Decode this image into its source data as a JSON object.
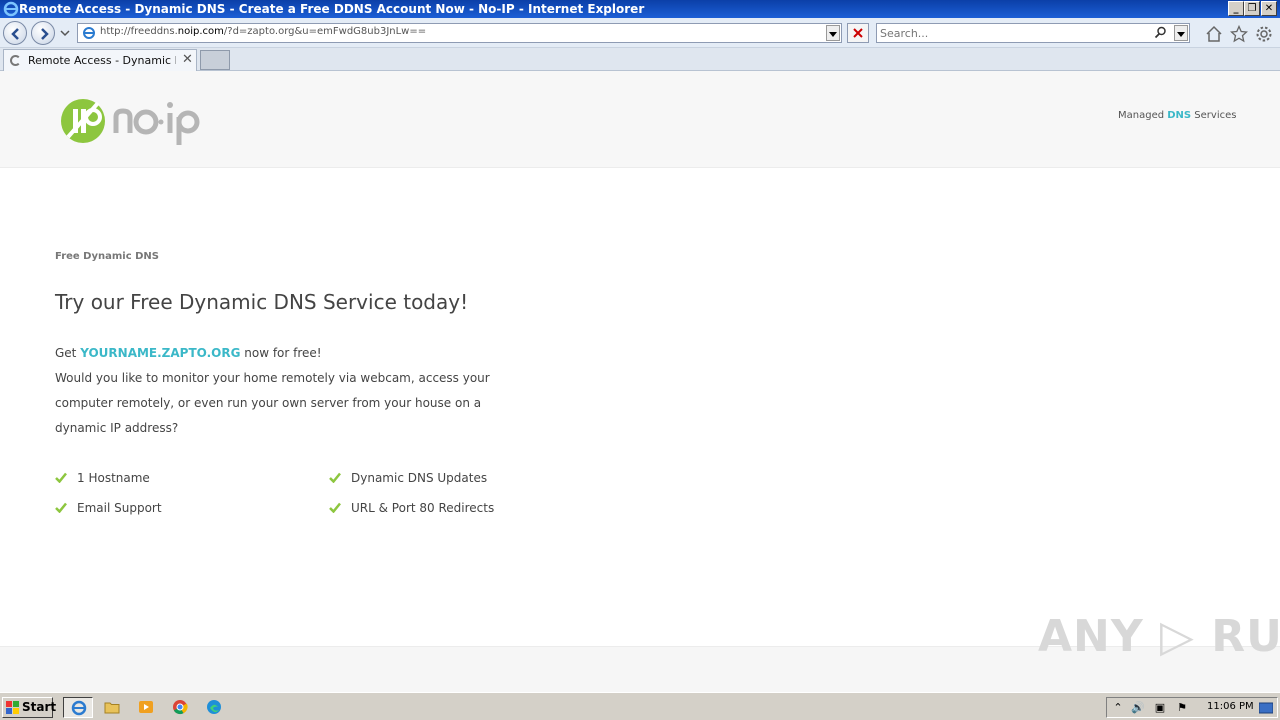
{
  "window": {
    "title": "Remote Access - Dynamic DNS - Create a Free DDNS Account Now - No-IP - Internet Explorer",
    "minimize": "_",
    "restore": "❐",
    "close": "✕"
  },
  "address_bar": {
    "url_prefix": "http://freeddns.",
    "url_domain": "noip.com",
    "url_suffix": "/?d=zapto.org&u=emFwdG8ub3JnLw=="
  },
  "search": {
    "placeholder": "Search..."
  },
  "tabs": [
    {
      "label": "Remote Access - Dynamic D...",
      "close": "✕"
    }
  ],
  "site": {
    "tagline_prefix": "Managed ",
    "tagline_highlight": "DNS",
    "tagline_suffix": " Services",
    "eyebrow": "Free Dynamic DNS",
    "headline": "Try our Free Dynamic DNS Service today!",
    "intro_get": "Get ",
    "intro_hostname": "YOURNAME.ZAPTO.ORG",
    "intro_after": " now for free!",
    "intro_body": "Would you like to monitor your home remotely via webcam, access your computer remotely, or even run your own server from your house on a dynamic IP address?",
    "features": [
      "1 Hostname",
      "Dynamic DNS Updates",
      "Email Support",
      "URL & Port 80 Redirects"
    ]
  },
  "watermark": "ANY ▷ RUN",
  "taskbar": {
    "start_label": "Start",
    "clock": "11:06 PM"
  },
  "colors": {
    "accent": "#3bb8c8",
    "check": "#8dc63f",
    "titlebar": "#0b3fa8"
  }
}
